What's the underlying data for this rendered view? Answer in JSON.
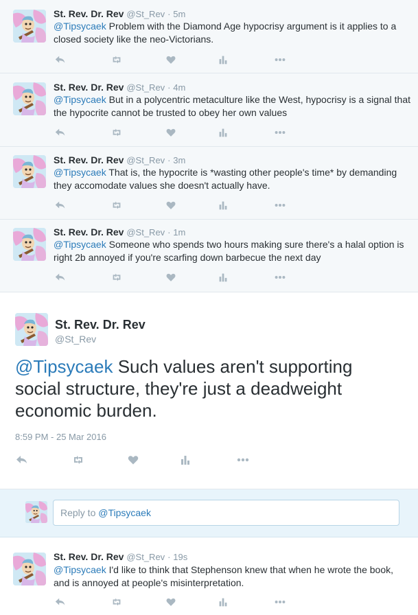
{
  "context_tweets": [
    {
      "fullname": "St. Rev. Dr. Rev",
      "screen_name": "@St_Rev",
      "time": "5m",
      "mention": "@Tipsycaek",
      "text": " Problem with the Diamond Age hypocrisy argument is it applies to a closed society like the neo-Victorians."
    },
    {
      "fullname": "St. Rev. Dr. Rev",
      "screen_name": "@St_Rev",
      "time": "4m",
      "mention": "@Tipsycaek",
      "text": " But in a polycentric metaculture like the West, hypocrisy is a signal that the hypocrite cannot be trusted to obey her own values"
    },
    {
      "fullname": "St. Rev. Dr. Rev",
      "screen_name": "@St_Rev",
      "time": "3m",
      "mention": "@Tipsycaek",
      "text": " That is, the hypocrite is *wasting other people's time* by demanding they accomodate values she doesn't actually have."
    },
    {
      "fullname": "St. Rev. Dr. Rev",
      "screen_name": "@St_Rev",
      "time": "1m",
      "mention": "@Tipsycaek",
      "text": " Someone who spends two hours making sure there's a halal option is right 2b annoyed if you're scarfing down barbecue the next day"
    }
  ],
  "permalink": {
    "fullname": "St. Rev. Dr. Rev",
    "screen_name": "@St_Rev",
    "mention": "@Tipsycaek",
    "text": " Such values aren't supporting social structure, they're just a deadweight economic burden.",
    "timestamp": "8:59 PM - 25 Mar 2016"
  },
  "reply": {
    "prefix": "Reply to ",
    "mention": "@Tipsycaek"
  },
  "reply_tweets": [
    {
      "fullname": "St. Rev. Dr. Rev",
      "screen_name": "@St_Rev",
      "time": "19s",
      "mention": "@Tipsycaek",
      "text": " I'd like to think that Stephenson knew that when he wrote the book, and is annoyed at people's misinterpretation."
    }
  ],
  "separator": "·",
  "icons": {
    "reply": "reply-icon",
    "retweet": "retweet-icon",
    "like": "heart-icon",
    "analytics": "analytics-icon",
    "more": "more-icon"
  },
  "colors": {
    "link": "#2b7bb9",
    "muted": "#8899a6",
    "action": "#aab8c2",
    "context_bg": "#f5f8fa",
    "reply_bg": "#e8f4fb"
  }
}
